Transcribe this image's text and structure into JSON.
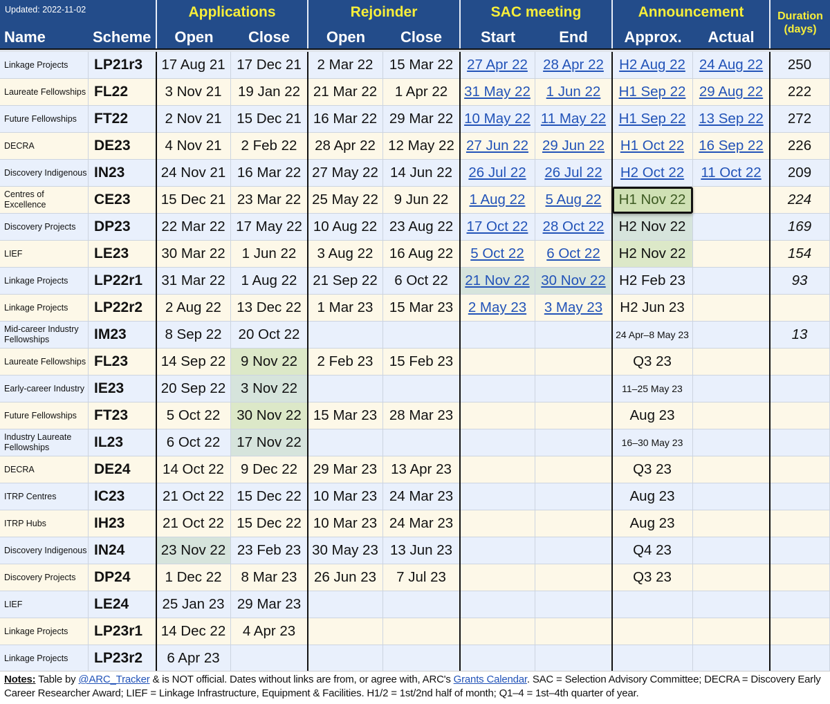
{
  "updated": "Updated: 2022-11-02",
  "header": {
    "name": "Name",
    "scheme": "Scheme",
    "groups": {
      "applications": "Applications",
      "rejoinder": "Rejoinder",
      "sac": "SAC meeting",
      "announcement": "Announcement",
      "duration": "Duration",
      "duration_unit": "(days)"
    },
    "sub": {
      "app_open": "Open",
      "app_close": "Close",
      "rej_open": "Open",
      "rej_close": "Close",
      "sac_start": "Start",
      "sac_end": "End",
      "ann_approx": "Approx.",
      "ann_actual": "Actual"
    }
  },
  "rows": [
    {
      "name": "Linkage Projects",
      "scheme": "LP21r3",
      "app_open": "17 Aug 21",
      "app_close": "17 Dec 21",
      "rej_open": "2 Mar 22",
      "rej_close": "15 Mar 22",
      "sac_start": "27 Apr 22",
      "sac_end": "28 Apr 22",
      "ann_approx": "H2 Aug 22",
      "ann_actual": "24 Aug 22",
      "duration": "250"
    },
    {
      "name": "Laureate Fellowships",
      "scheme": "FL22",
      "app_open": "3 Nov 21",
      "app_close": "19 Jan 22",
      "rej_open": "21 Mar 22",
      "rej_close": "1 Apr 22",
      "sac_start": "31 May 22",
      "sac_end": "1 Jun 22",
      "ann_approx": "H1 Sep 22",
      "ann_actual": "29 Aug 22",
      "duration": "222"
    },
    {
      "name": "Future Fellowships",
      "scheme": "FT22",
      "app_open": "2 Nov 21",
      "app_close": "15 Dec 21",
      "rej_open": "16 Mar 22",
      "rej_close": "29 Mar 22",
      "sac_start": "10 May 22",
      "sac_end": "11 May 22",
      "ann_approx": "H1 Sep 22",
      "ann_actual": "13 Sep 22",
      "duration": "272"
    },
    {
      "name": "DECRA",
      "scheme": "DE23",
      "app_open": "4 Nov 21",
      "app_close": "2 Feb 22",
      "rej_open": "28 Apr 22",
      "rej_close": "12 May 22",
      "sac_start": "27 Jun 22",
      "sac_end": "29 Jun 22",
      "ann_approx": "H1 Oct 22",
      "ann_actual": "16 Sep 22",
      "duration": "226"
    },
    {
      "name": "Discovery Indigenous",
      "scheme": "IN23",
      "app_open": "24 Nov 21",
      "app_close": "16 Mar 22",
      "rej_open": "27 May 22",
      "rej_close": "14 Jun 22",
      "sac_start": "26 Jul 22",
      "sac_end": "26 Jul 22",
      "ann_approx": "H2 Oct 22",
      "ann_actual": "11 Oct 22",
      "duration": "209"
    },
    {
      "name": "Centres of Excellence",
      "scheme": "CE23",
      "app_open": "15 Dec 21",
      "app_close": "23 Mar 22",
      "rej_open": "25 May 22",
      "rej_close": "9 Jun 22",
      "sac_start": "1 Aug 22",
      "sac_end": "5 Aug 22",
      "ann_approx": "H1 Nov 22",
      "ann_actual": "",
      "duration": "224"
    },
    {
      "name": "Discovery Projects",
      "scheme": "DP23",
      "app_open": "22 Mar 22",
      "app_close": "17 May 22",
      "rej_open": "10 Aug 22",
      "rej_close": "23 Aug 22",
      "sac_start": "17 Oct 22",
      "sac_end": "28 Oct 22",
      "ann_approx": "H2 Nov 22",
      "ann_actual": "",
      "duration": "169"
    },
    {
      "name": "LIEF",
      "scheme": "LE23",
      "app_open": "30 Mar 22",
      "app_close": "1 Jun 22",
      "rej_open": "3 Aug 22",
      "rej_close": "16 Aug 22",
      "sac_start": "5 Oct 22",
      "sac_end": "6 Oct 22",
      "ann_approx": "H2 Nov 22",
      "ann_actual": "",
      "duration": "154"
    },
    {
      "name": "Linkage Projects",
      "scheme": "LP22r1",
      "app_open": "31 Mar 22",
      "app_close": "1 Aug 22",
      "rej_open": "21 Sep 22",
      "rej_close": "6 Oct 22",
      "sac_start": "21 Nov 22",
      "sac_end": "30 Nov 22",
      "ann_approx": "H2 Feb 23",
      "ann_actual": "",
      "duration": "93"
    },
    {
      "name": "Linkage Projects",
      "scheme": "LP22r2",
      "app_open": "2 Aug 22",
      "app_close": "13 Dec 22",
      "rej_open": "1 Mar 23",
      "rej_close": "15 Mar 23",
      "sac_start": "2 May 23",
      "sac_end": "3 May 23",
      "ann_approx": "H2 Jun 23",
      "ann_actual": "",
      "duration": ""
    },
    {
      "name": "Mid-career Industry Fellowships",
      "scheme": "IM23",
      "app_open": "8 Sep 22",
      "app_close": "20 Oct 22",
      "rej_open": "",
      "rej_close": "",
      "sac_start": "",
      "sac_end": "",
      "ann_approx": "24 Apr–8 May 23",
      "ann_actual": "",
      "duration": "13"
    },
    {
      "name": "Laureate Fellowships",
      "scheme": "FL23",
      "app_open": "14 Sep 22",
      "app_close": "9 Nov 22",
      "rej_open": "2 Feb 23",
      "rej_close": "15 Feb 23",
      "sac_start": "",
      "sac_end": "",
      "ann_approx": "Q3 23",
      "ann_actual": "",
      "duration": ""
    },
    {
      "name": "Early-career Industry",
      "scheme": "IE23",
      "app_open": "20 Sep 22",
      "app_close": "3 Nov 22",
      "rej_open": "",
      "rej_close": "",
      "sac_start": "",
      "sac_end": "",
      "ann_approx": "11–25 May 23",
      "ann_actual": "",
      "duration": ""
    },
    {
      "name": "Future Fellowships",
      "scheme": "FT23",
      "app_open": "5 Oct 22",
      "app_close": "30 Nov 22",
      "rej_open": "15 Mar 23",
      "rej_close": "28 Mar 23",
      "sac_start": "",
      "sac_end": "",
      "ann_approx": "Aug 23",
      "ann_actual": "",
      "duration": ""
    },
    {
      "name": "Industry Laureate Fellowships",
      "scheme": "IL23",
      "app_open": "6 Oct 22",
      "app_close": "17 Nov 22",
      "rej_open": "",
      "rej_close": "",
      "sac_start": "",
      "sac_end": "",
      "ann_approx": "16–30 May 23",
      "ann_actual": "",
      "duration": ""
    },
    {
      "name": "DECRA",
      "scheme": "DE24",
      "app_open": "14 Oct 22",
      "app_close": "9 Dec 22",
      "rej_open": "29 Mar 23",
      "rej_close": "13 Apr 23",
      "sac_start": "",
      "sac_end": "",
      "ann_approx": "Q3 23",
      "ann_actual": "",
      "duration": ""
    },
    {
      "name": "ITRP Centres",
      "scheme": "IC23",
      "app_open": "21 Oct 22",
      "app_close": "15 Dec 22",
      "rej_open": "10 Mar 23",
      "rej_close": "24 Mar 23",
      "sac_start": "",
      "sac_end": "",
      "ann_approx": "Aug 23",
      "ann_actual": "",
      "duration": ""
    },
    {
      "name": "ITRP Hubs",
      "scheme": "IH23",
      "app_open": "21 Oct 22",
      "app_close": "15 Dec 22",
      "rej_open": "10 Mar 23",
      "rej_close": "24 Mar 23",
      "sac_start": "",
      "sac_end": "",
      "ann_approx": "Aug 23",
      "ann_actual": "",
      "duration": ""
    },
    {
      "name": "Discovery Indigenous",
      "scheme": "IN24",
      "app_open": "23 Nov 22",
      "app_close": "23 Feb 23",
      "rej_open": "30 May 23",
      "rej_close": "13 Jun 23",
      "sac_start": "",
      "sac_end": "",
      "ann_approx": "Q4 23",
      "ann_actual": "",
      "duration": ""
    },
    {
      "name": "Discovery Projects",
      "scheme": "DP24",
      "app_open": "1 Dec 22",
      "app_close": "8 Mar 23",
      "rej_open": "26 Jun 23",
      "rej_close": "7 Jul 23",
      "sac_start": "",
      "sac_end": "",
      "ann_approx": "Q3 23",
      "ann_actual": "",
      "duration": ""
    },
    {
      "name": "LIEF",
      "scheme": "LE24",
      "app_open": "25 Jan 23",
      "app_close": "29 Mar 23",
      "rej_open": "",
      "rej_close": "",
      "sac_start": "",
      "sac_end": "",
      "ann_approx": "",
      "ann_actual": "",
      "duration": ""
    },
    {
      "name": "Linkage Projects",
      "scheme": "LP23r1",
      "app_open": "14 Dec 22",
      "app_close": "4 Apr 23",
      "rej_open": "",
      "rej_close": "",
      "sac_start": "",
      "sac_end": "",
      "ann_approx": "",
      "ann_actual": "",
      "duration": ""
    },
    {
      "name": "Linkage Projects",
      "scheme": "LP23r2",
      "app_open": "6 Apr 23",
      "app_close": "",
      "rej_open": "",
      "rej_close": "",
      "sac_start": "",
      "sac_end": "",
      "ann_approx": "",
      "ann_actual": "",
      "duration": ""
    }
  ],
  "notes": {
    "label": "Notes:",
    "t1": " Table by ",
    "link1": "@ARC_Tracker",
    "t2": " & is NOT official. Dates without links are from, or agree with, ARC's ",
    "link2": "Grants Calendar",
    "t3": ". SAC = Selection Advisory Committee; DECRA = Discovery Early Career Researcher Award; LIEF = Linkage Infrastructure, Equipment & Facilities. H1/2 = 1st/2nd half of month; Q1–4 = 1st–4th quarter of year."
  },
  "colors": {
    "header_bg": "#234c8a",
    "group_header_text": "#f7ee3a",
    "link": "#2253b8",
    "row_blue": "#e9f0fc",
    "row_yellow": "#fdf8e8",
    "highlight_green": "#dce8c8",
    "highlight_teal": "#d6e4dc"
  }
}
